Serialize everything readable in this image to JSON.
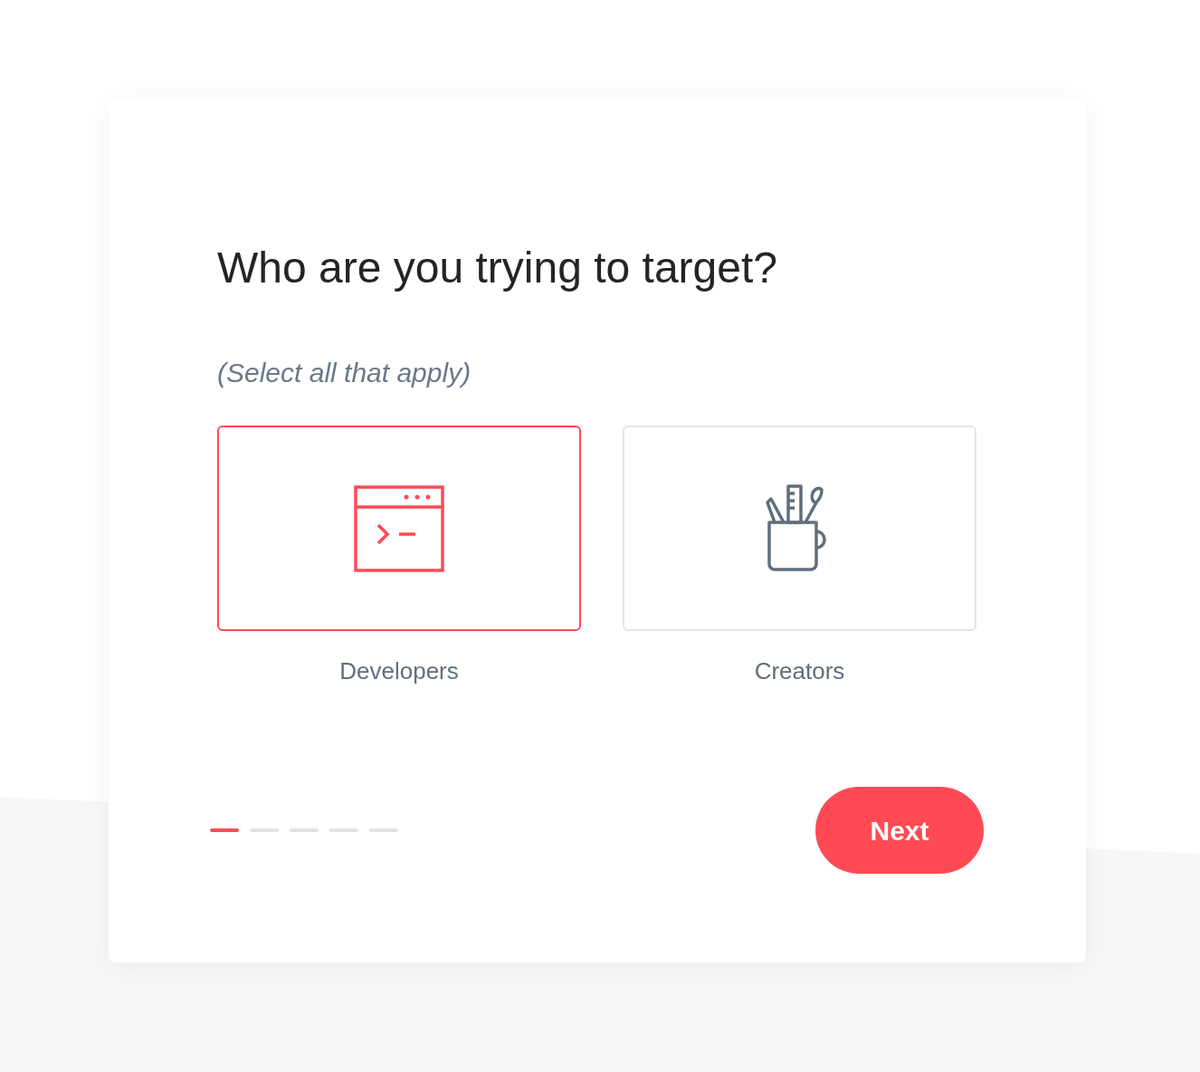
{
  "card": {
    "title": "Who are you trying to target?",
    "subtitle": "(Select all that apply)",
    "options": [
      {
        "kind": "terminal",
        "label": "Developers",
        "selected": true
      },
      {
        "kind": "tools",
        "label": "Creators",
        "selected": false
      }
    ],
    "steps": [
      {
        "selected": true
      },
      {
        "selected": false
      },
      {
        "selected": false
      },
      {
        "selected": false
      },
      {
        "selected": false
      }
    ],
    "next_button": "Next"
  }
}
